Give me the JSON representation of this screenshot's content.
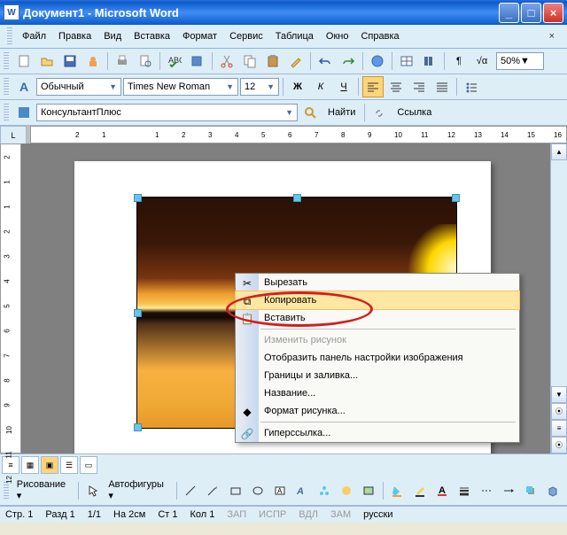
{
  "window": {
    "title": "Документ1 - Microsoft Word",
    "icon": "W"
  },
  "menu": [
    "Файл",
    "Правка",
    "Вид",
    "Вставка",
    "Формат",
    "Сервис",
    "Таблица",
    "Окно",
    "Справка"
  ],
  "fmt": {
    "style": "Обычный",
    "font": "Times New Roman",
    "size": "12"
  },
  "ext": {
    "name": "КонсультантПлюс",
    "find": "Найти",
    "link": "Ссылка"
  },
  "zoom": "50%",
  "ruler_corner": "L",
  "ruler_h": [
    "2",
    "1",
    "",
    "1",
    "2",
    "3",
    "4",
    "5",
    "6",
    "7",
    "8",
    "9",
    "10",
    "11",
    "12",
    "13",
    "14",
    "15",
    "16"
  ],
  "ruler_v": [
    "2",
    "1",
    "1",
    "2",
    "3",
    "4",
    "5",
    "6",
    "7",
    "8",
    "9",
    "10",
    "11",
    "12"
  ],
  "ctx": [
    {
      "icon": "✂",
      "label": "Вырезать",
      "en": true
    },
    {
      "icon": "⧉",
      "label": "Копировать",
      "en": true,
      "hl": true
    },
    {
      "icon": "📋",
      "label": "Вставить",
      "en": true
    },
    {
      "sep": true
    },
    {
      "label": "Изменить рисунок",
      "en": false
    },
    {
      "label": "Отобразить панель настройки изображения",
      "en": true
    },
    {
      "label": "Границы и заливка...",
      "en": true
    },
    {
      "label": "Название...",
      "en": true
    },
    {
      "icon": "◆",
      "label": "Формат рисунка...",
      "en": true
    },
    {
      "sep": true
    },
    {
      "icon": "🔗",
      "label": "Гиперссылка...",
      "en": true
    }
  ],
  "draw": {
    "label": "Рисование",
    "shapes": "Автофигуры"
  },
  "status": {
    "page": "Стр. 1",
    "sect": "Разд 1",
    "pages": "1/1",
    "pos": "На 2см",
    "line": "Ст 1",
    "col": "Кол 1",
    "flags": [
      "ЗАП",
      "ИСПР",
      "ВДЛ",
      "ЗАМ"
    ],
    "lang": "русски"
  }
}
